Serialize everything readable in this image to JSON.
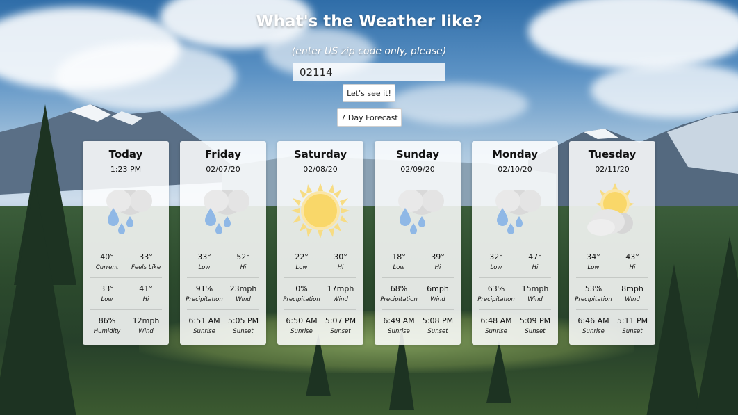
{
  "header": {
    "title": "What's the Weather like?",
    "hint": "(enter US zip code only, please)"
  },
  "zip": {
    "value": "02114"
  },
  "buttons": {
    "see": "Let's see it!",
    "forecast": "7 Day Forecast"
  },
  "cards": [
    {
      "day": "Today",
      "sub": "1:23 PM",
      "icon": "rain-cloud-icon",
      "rows": [
        [
          {
            "v": "40°",
            "l": "Current"
          },
          {
            "v": "33°",
            "l": "Feels Like"
          }
        ],
        [
          {
            "v": "33°",
            "l": "Low"
          },
          {
            "v": "41°",
            "l": "Hi"
          }
        ],
        [
          {
            "v": "86%",
            "l": "Humidity"
          },
          {
            "v": "12mph",
            "l": "Wind"
          }
        ]
      ]
    },
    {
      "day": "Friday",
      "sub": "02/07/20",
      "icon": "rain-cloud-icon",
      "rows": [
        [
          {
            "v": "33°",
            "l": "Low"
          },
          {
            "v": "52°",
            "l": "Hi"
          }
        ],
        [
          {
            "v": "91%",
            "l": "Precipitation"
          },
          {
            "v": "23mph",
            "l": "Wind"
          }
        ],
        [
          {
            "v": "6:51 AM",
            "l": "Sunrise"
          },
          {
            "v": "5:05 PM",
            "l": "Sunset"
          }
        ]
      ]
    },
    {
      "day": "Saturday",
      "sub": "02/08/20",
      "icon": "sun-icon",
      "rows": [
        [
          {
            "v": "22°",
            "l": "Low"
          },
          {
            "v": "30°",
            "l": "Hi"
          }
        ],
        [
          {
            "v": "0%",
            "l": "Precipitation"
          },
          {
            "v": "17mph",
            "l": "Wind"
          }
        ],
        [
          {
            "v": "6:50 AM",
            "l": "Sunrise"
          },
          {
            "v": "5:07 PM",
            "l": "Sunset"
          }
        ]
      ]
    },
    {
      "day": "Sunday",
      "sub": "02/09/20",
      "icon": "rain-cloud-icon",
      "rows": [
        [
          {
            "v": "18°",
            "l": "Low"
          },
          {
            "v": "39°",
            "l": "Hi"
          }
        ],
        [
          {
            "v": "68%",
            "l": "Precipitation"
          },
          {
            "v": "6mph",
            "l": "Wind"
          }
        ],
        [
          {
            "v": "6:49 AM",
            "l": "Sunrise"
          },
          {
            "v": "5:08 PM",
            "l": "Sunset"
          }
        ]
      ]
    },
    {
      "day": "Monday",
      "sub": "02/10/20",
      "icon": "rain-cloud-icon",
      "rows": [
        [
          {
            "v": "32°",
            "l": "Low"
          },
          {
            "v": "47°",
            "l": "Hi"
          }
        ],
        [
          {
            "v": "63%",
            "l": "Precipitation"
          },
          {
            "v": "15mph",
            "l": "Wind"
          }
        ],
        [
          {
            "v": "6:48 AM",
            "l": "Sunrise"
          },
          {
            "v": "5:09 PM",
            "l": "Sunset"
          }
        ]
      ]
    },
    {
      "day": "Tuesday",
      "sub": "02/11/20",
      "icon": "partly-cloudy-icon",
      "rows": [
        [
          {
            "v": "34°",
            "l": "Low"
          },
          {
            "v": "43°",
            "l": "Hi"
          }
        ],
        [
          {
            "v": "53%",
            "l": "Precipitation"
          },
          {
            "v": "8mph",
            "l": "Wind"
          }
        ],
        [
          {
            "v": "6:46 AM",
            "l": "Sunrise"
          },
          {
            "v": "5:11 PM",
            "l": "Sunset"
          }
        ]
      ]
    }
  ]
}
